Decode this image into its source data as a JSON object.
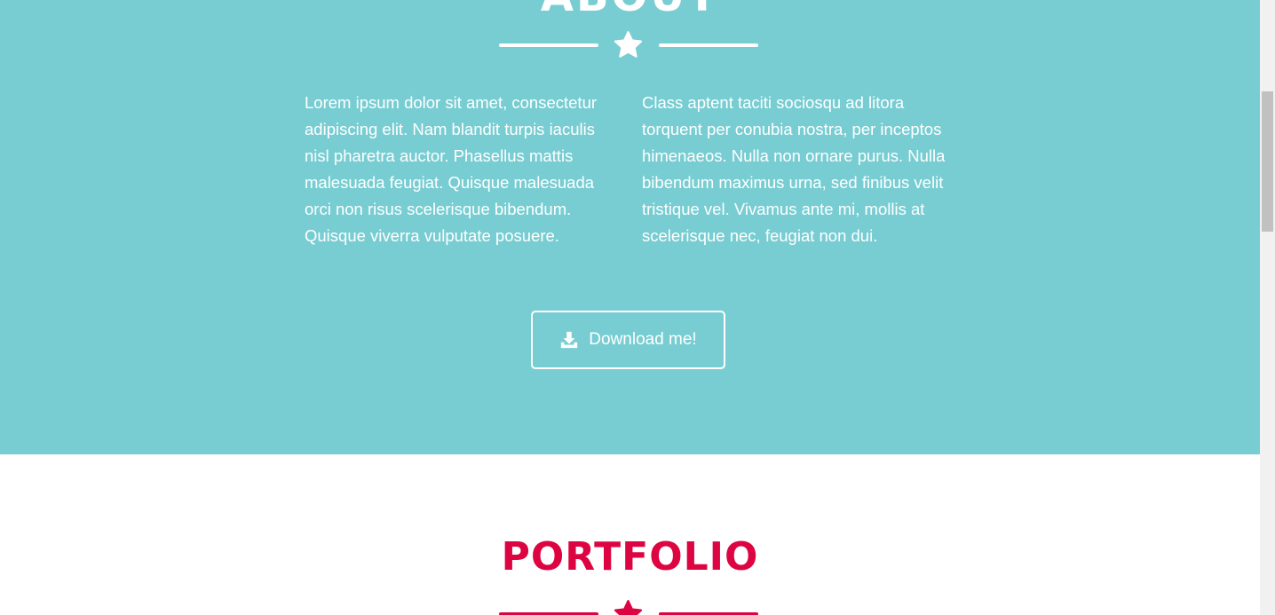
{
  "about": {
    "title": "ABOUT",
    "divider_icon": "star-icon",
    "paragraph_left": "Lorem ipsum dolor sit amet, consectetur adipiscing elit. Nam blandit turpis iaculis nisl pharetra auctor. Phasellus mattis malesuada feugiat. Quisque malesuada orci non risus scelerisque bibendum. Quisque viverra vulputate posuere.",
    "paragraph_right": "Class aptent taciti sociosqu ad litora torquent per conubia nostra, per inceptos himenaeos. Nulla non ornare purus. Nulla bibendum maximus urna, sed finibus velit tristique vel. Vivamus ante mi, mollis at scelerisque nec, feugiat non dui.",
    "download_button": {
      "label": "Download me!",
      "icon": "download-icon"
    }
  },
  "portfolio": {
    "title": "PORTFOLIO",
    "divider_icon": "star-icon"
  },
  "colors": {
    "about_background": "#78cdd2",
    "about_text": "#ffffff",
    "portfolio_accent": "#dc0542",
    "page_background": "#ffffff",
    "scrollbar_track": "#f1f1f1",
    "scrollbar_thumb": "#c1c1c1"
  }
}
